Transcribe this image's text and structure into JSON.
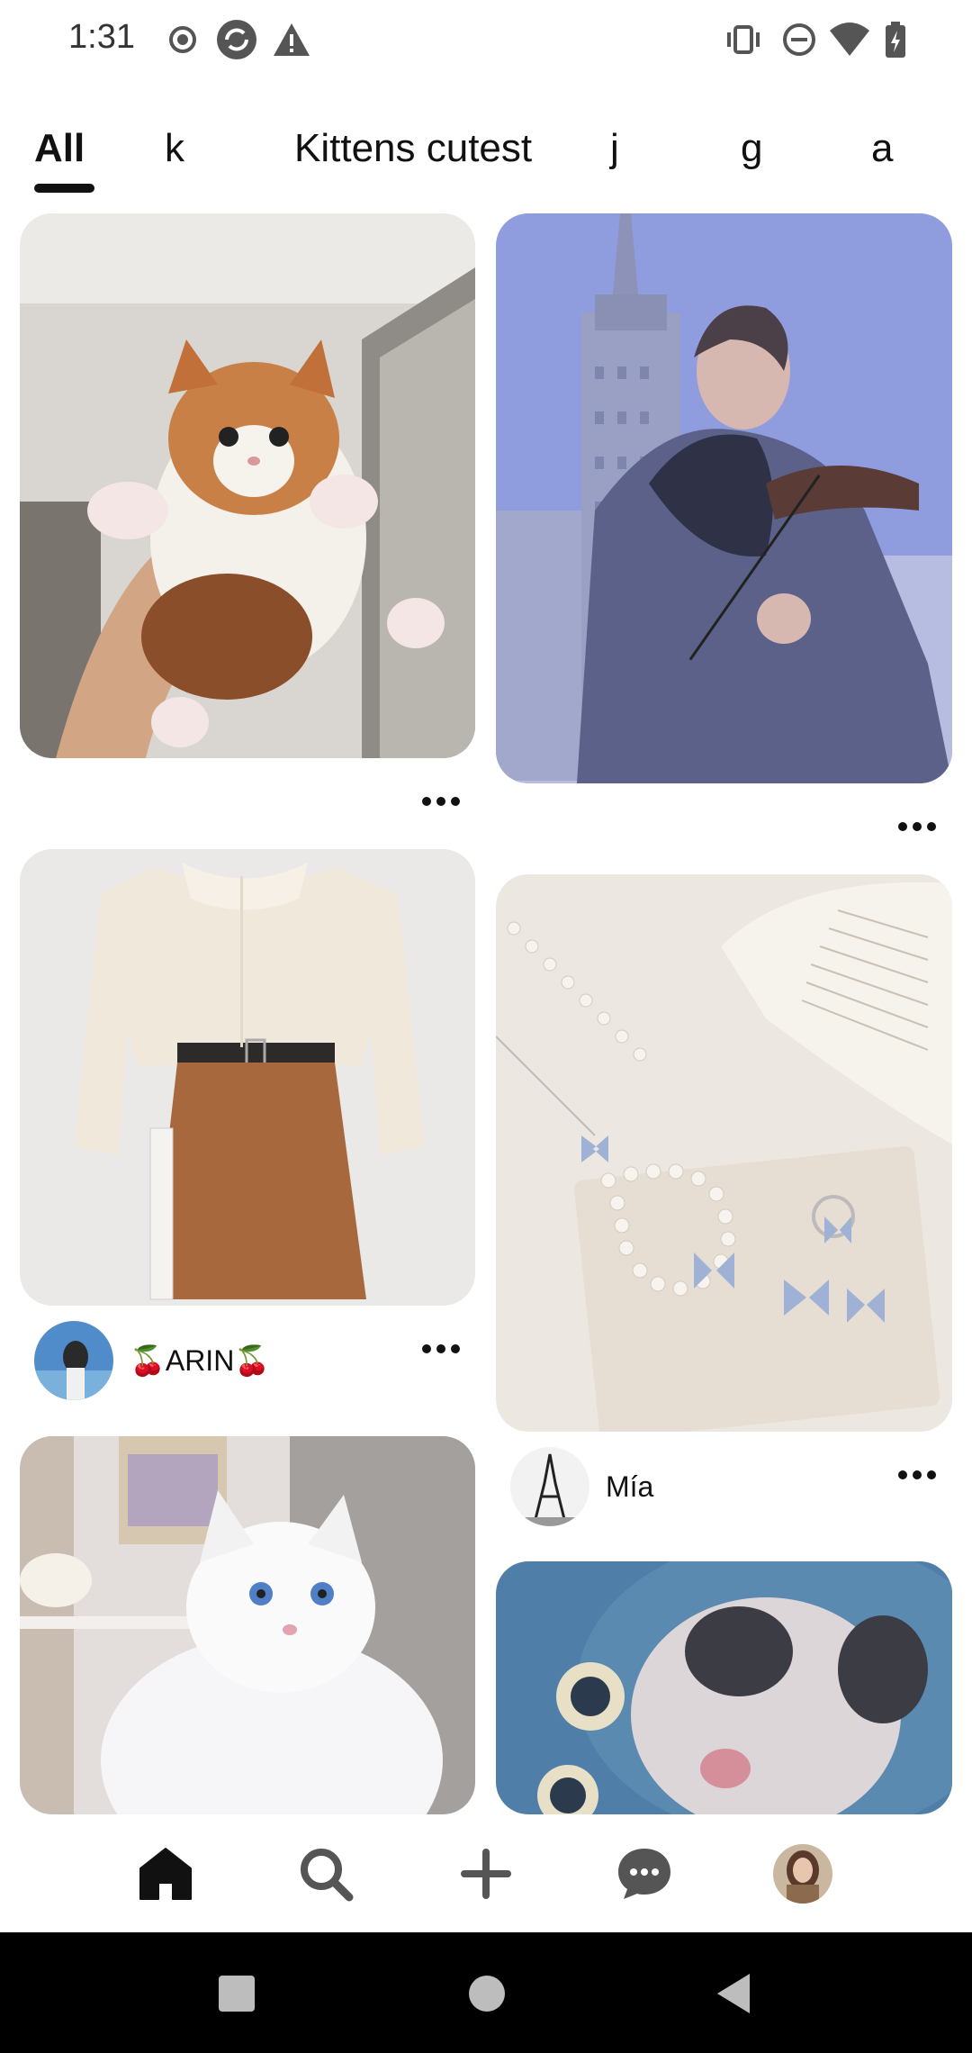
{
  "status_bar": {
    "time": "1:31",
    "left_icons": [
      "record-icon",
      "sync-icon",
      "warning-icon"
    ],
    "right_icons": [
      "vibrate-icon",
      "do-not-disturb-icon",
      "wifi-icon",
      "battery-charging-icon"
    ]
  },
  "tabs": [
    {
      "label": "All",
      "active": true
    },
    {
      "label": "k",
      "active": false
    },
    {
      "label": "Kittens cutest",
      "active": false
    },
    {
      "label": "j",
      "active": false
    },
    {
      "label": "g",
      "active": false
    },
    {
      "label": "a",
      "active": false
    }
  ],
  "feed": {
    "pins": [
      {
        "image": "orange-white-kitten-photo",
        "author": ""
      },
      {
        "image": "violinist-photo",
        "author": ""
      },
      {
        "image": "blouse-skirt-outfit-photo",
        "author": "🍒ARIN🍒"
      },
      {
        "image": "pearl-butterfly-jewelry-photo",
        "author": "Mía"
      },
      {
        "image": "white-fluffy-cat-photo",
        "author": ""
      },
      {
        "image": "cat-blue-blanket-photo",
        "author": ""
      }
    ]
  },
  "bottom_nav": {
    "items": [
      "home-icon",
      "search-icon",
      "create-icon",
      "messages-icon",
      "profile-avatar"
    ]
  },
  "system_nav": [
    "recents-button",
    "home-button",
    "back-button"
  ],
  "colors": {
    "text": "#111111",
    "background": "#ffffff",
    "nav_bar": "#000000"
  }
}
